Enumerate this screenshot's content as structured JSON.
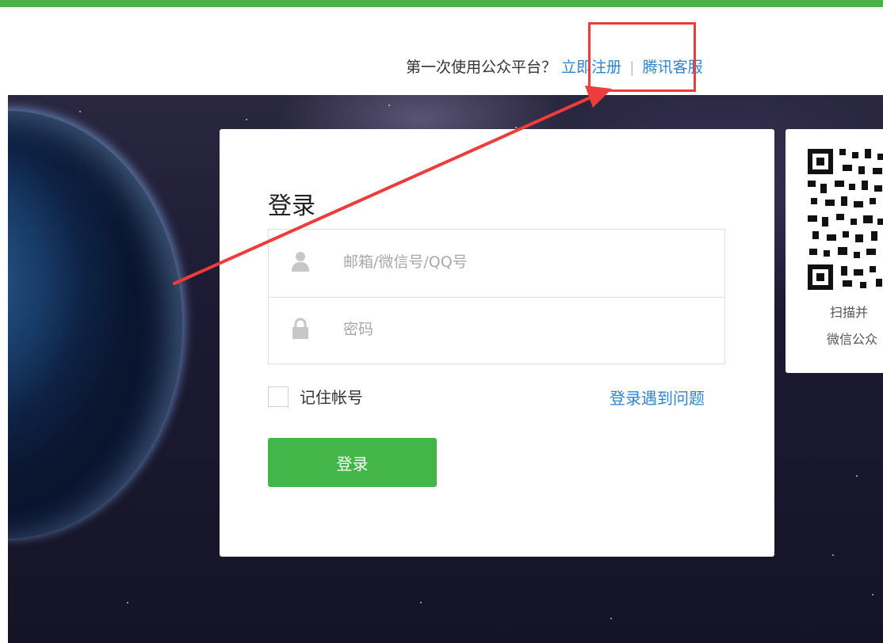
{
  "header": {
    "prompt_text": "第一次使用公众平台？",
    "register_link": "立即注册",
    "separator": "|",
    "service_link": "腾讯客服"
  },
  "login": {
    "title": "登录",
    "account_placeholder": "邮箱/微信号/QQ号",
    "password_placeholder": "密码",
    "remember_label": "记住帐号",
    "trouble_link": "登录遇到问题",
    "submit_label": "登录"
  },
  "qr_panel": {
    "line1": "扫描并",
    "line2": "微信公众"
  },
  "colors": {
    "top_bar": "#4cb04b",
    "link": "#2f84d0",
    "login_button": "#44b549",
    "annotation": "#ee3b3b"
  },
  "icons": {
    "account": "user-icon",
    "password": "lock-icon"
  }
}
